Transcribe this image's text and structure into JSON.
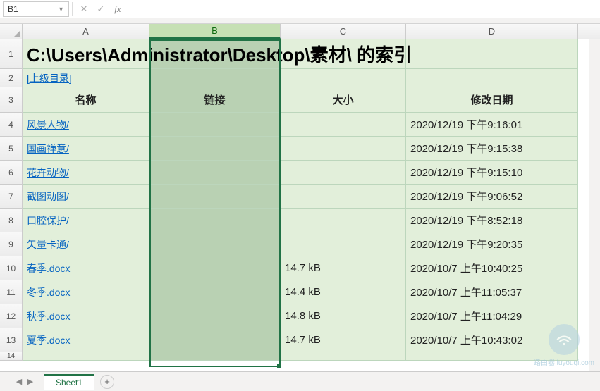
{
  "name_box": "B1",
  "title": "C:\\Users\\Administrator\\Desktop\\素材\\ 的索引",
  "parent_dir_label": "[上级目录]",
  "columns": {
    "A": "A",
    "B": "B",
    "C": "C",
    "D": "D"
  },
  "headers": {
    "name": "名称",
    "link": "链接",
    "size": "大小",
    "modified": "修改日期"
  },
  "rows": [
    {
      "name": "风景人物/",
      "size": "",
      "modified": "2020/12/19 下午9:16:01"
    },
    {
      "name": "国画禅意/",
      "size": "",
      "modified": "2020/12/19 下午9:15:38"
    },
    {
      "name": "花卉动物/",
      "size": "",
      "modified": "2020/12/19 下午9:15:10"
    },
    {
      "name": "截图动图/",
      "size": "",
      "modified": "2020/12/19 下午9:06:52"
    },
    {
      "name": "口腔保护/",
      "size": "",
      "modified": "2020/12/19 下午8:52:18"
    },
    {
      "name": "矢量卡通/",
      "size": "",
      "modified": "2020/12/19 下午9:20:35"
    },
    {
      "name": "春季.docx",
      "size": "14.7 kB",
      "modified": "2020/10/7 上午10:40:25"
    },
    {
      "name": "冬季.docx",
      "size": "14.4 kB",
      "modified": "2020/10/7 上午11:05:37"
    },
    {
      "name": "秋季.docx",
      "size": "14.8 kB",
      "modified": "2020/10/7 上午11:04:29"
    },
    {
      "name": "夏季.docx",
      "size": "14.7 kB",
      "modified": "2020/10/7 上午10:43:02"
    }
  ],
  "sheet_tab": "Sheet1",
  "watermark_text": "路由器 luyouqi.com"
}
